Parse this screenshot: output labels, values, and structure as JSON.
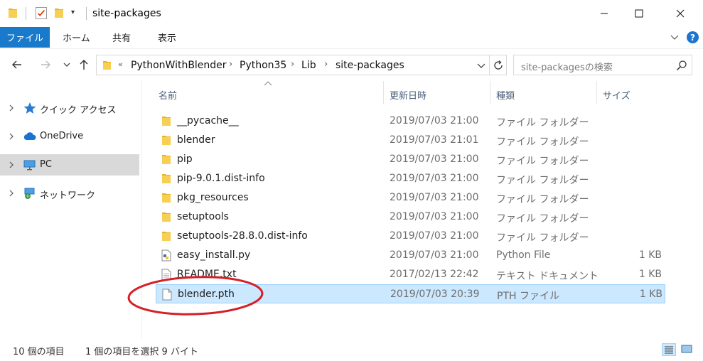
{
  "window": {
    "title": "site-packages"
  },
  "ribbon": {
    "tabs": [
      "ファイル",
      "ホーム",
      "共有",
      "表示"
    ]
  },
  "address": {
    "more": "«",
    "crumbs": [
      "PythonWithBlender",
      "Python35",
      "Lib",
      "site-packages"
    ],
    "separator": "›"
  },
  "search": {
    "placeholder": "site-packagesの検索"
  },
  "nav_pane": {
    "items": [
      {
        "label": "クイック アクセス",
        "icon": "star-icon"
      },
      {
        "label": "OneDrive",
        "icon": "cloud-icon"
      },
      {
        "label": "PC",
        "icon": "computer-icon"
      },
      {
        "label": "ネットワーク",
        "icon": "network-icon"
      }
    ]
  },
  "columns": {
    "name": "名前",
    "date": "更新日時",
    "type": "種類",
    "size": "サイズ"
  },
  "files": [
    {
      "name": "__pycache__",
      "date": "2019/07/03 21:00",
      "type": "ファイル フォルダー",
      "size": "",
      "icon": "folder-icon"
    },
    {
      "name": "blender",
      "date": "2019/07/03 21:01",
      "type": "ファイル フォルダー",
      "size": "",
      "icon": "folder-icon"
    },
    {
      "name": "pip",
      "date": "2019/07/03 21:00",
      "type": "ファイル フォルダー",
      "size": "",
      "icon": "folder-icon"
    },
    {
      "name": "pip-9.0.1.dist-info",
      "date": "2019/07/03 21:00",
      "type": "ファイル フォルダー",
      "size": "",
      "icon": "folder-icon"
    },
    {
      "name": "pkg_resources",
      "date": "2019/07/03 21:00",
      "type": "ファイル フォルダー",
      "size": "",
      "icon": "folder-icon"
    },
    {
      "name": "setuptools",
      "date": "2019/07/03 21:00",
      "type": "ファイル フォルダー",
      "size": "",
      "icon": "folder-icon"
    },
    {
      "name": "setuptools-28.8.0.dist-info",
      "date": "2019/07/03 21:00",
      "type": "ファイル フォルダー",
      "size": "",
      "icon": "folder-icon"
    },
    {
      "name": "easy_install.py",
      "date": "2019/07/03 21:00",
      "type": "Python File",
      "size": "1 KB",
      "icon": "python-file-icon"
    },
    {
      "name": "README.txt",
      "date": "2017/02/13 22:42",
      "type": "テキスト ドキュメント",
      "size": "1 KB",
      "icon": "text-file-icon"
    },
    {
      "name": "blender.pth",
      "date": "2019/07/03 20:39",
      "type": "PTH ファイル",
      "size": "1 KB",
      "icon": "file-icon",
      "selected": true
    }
  ],
  "status": {
    "item_count": "10 個の項目",
    "selection": "1 個の項目を選択  9 バイト"
  },
  "colors": {
    "accent": "#1979ca",
    "selection_bg": "#cce8ff",
    "selection_border": "#99d1ff",
    "annotation": "#d42027"
  }
}
